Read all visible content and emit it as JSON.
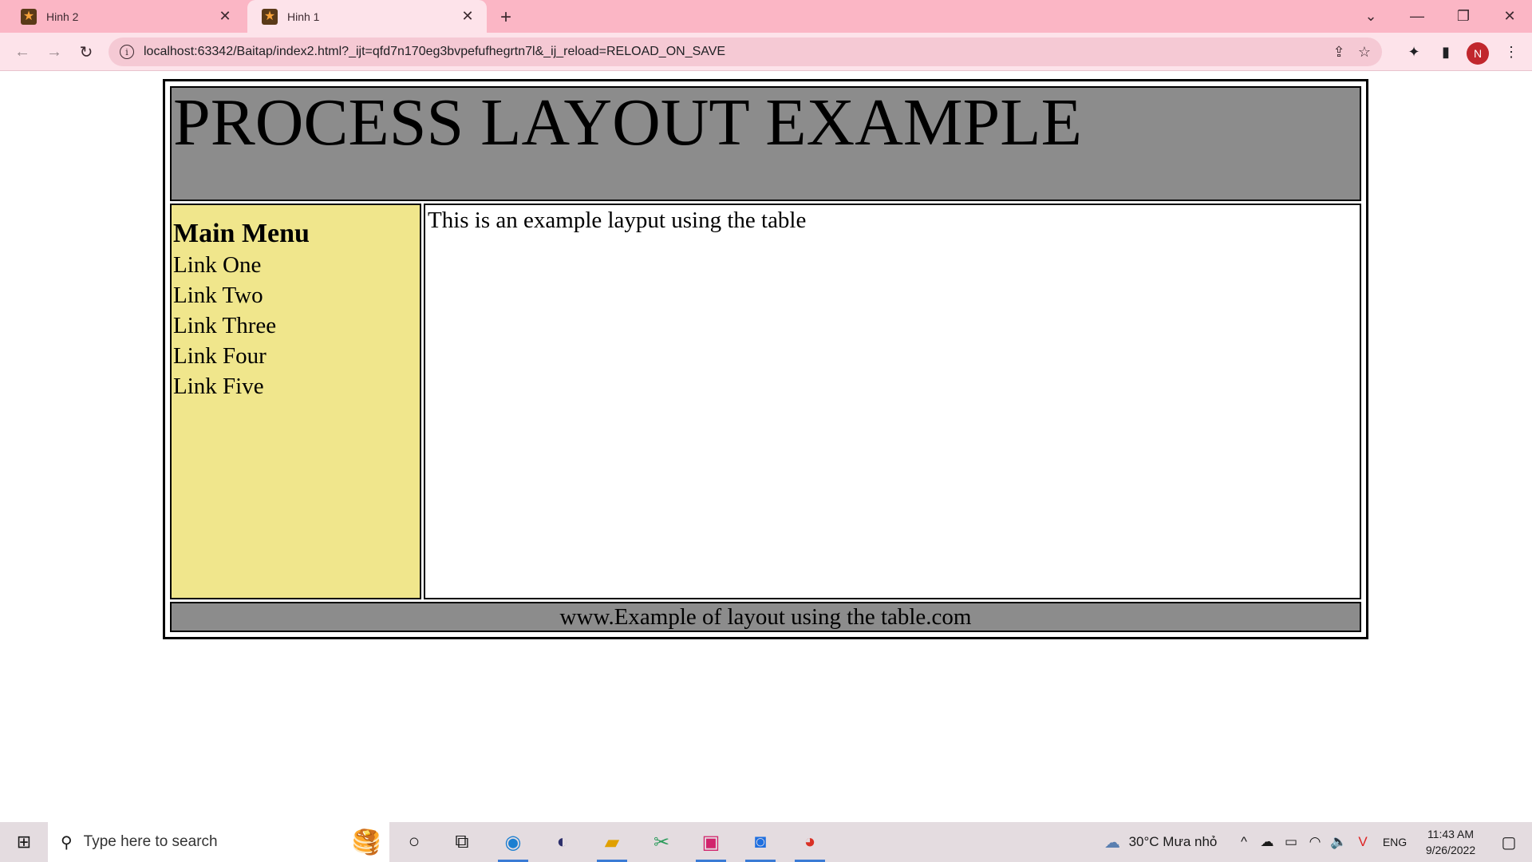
{
  "browser": {
    "tabs": [
      {
        "title": "Hinh 2",
        "active": false
      },
      {
        "title": "Hinh 1",
        "active": true
      }
    ],
    "url": "localhost:63342/Baitap/index2.html?_ijt=qfd7n170eg3bvpefufhegrtn7l&_ij_reload=RELOAD_ON_SAVE",
    "avatar_letter": "N",
    "accent_color": "#fbb6c5"
  },
  "page": {
    "header_title": "PROCESS LAYOUT EXAMPLE",
    "menu_title": "Main Menu",
    "menu_links": [
      "Link One",
      "Link Two",
      "Link Three",
      "Link Four",
      "Link Five"
    ],
    "content_text": "This is an example layput using the table",
    "footer_text": "www.Example of layout using the table.com",
    "colors": {
      "header_bg": "#8c8c8c",
      "menu_bg": "#f0e68c",
      "content_bg": "#ffffff"
    }
  },
  "taskbar": {
    "search_placeholder": "Type here to search",
    "weather": "30°C  Mưa nhỏ",
    "language": "ENG",
    "time": "11:43 AM",
    "date": "9/26/2022"
  }
}
